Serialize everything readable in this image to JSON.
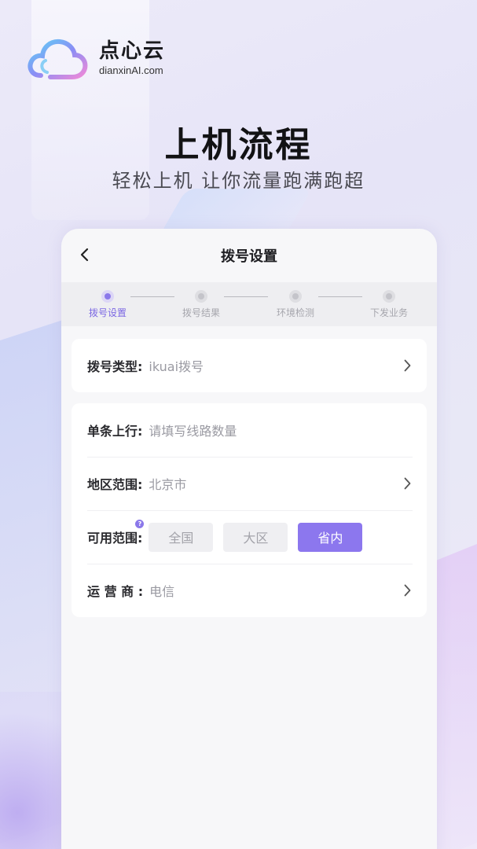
{
  "brand": {
    "name": "点心云",
    "domain": "dianxinAI.com"
  },
  "hero": {
    "title": "上机流程",
    "subtitle": "轻松上机 让你流量跑满跑超"
  },
  "card": {
    "title": "拨号设置",
    "steps": [
      {
        "label": "拨号设置",
        "active": true
      },
      {
        "label": "拨号结果",
        "active": false
      },
      {
        "label": "环境检测",
        "active": false
      },
      {
        "label": "下发业务",
        "active": false
      }
    ],
    "dial_type": {
      "label": "拨号类型:",
      "value": "ikuai拨号"
    },
    "uplink": {
      "label": "单条上行:",
      "placeholder": "请填写线路数量"
    },
    "region": {
      "label": "地区范围:",
      "value": "北京市"
    },
    "available_range": {
      "label": "可用范围:",
      "help": "?",
      "options": [
        "全国",
        "大区",
        "省内"
      ],
      "selected": "省内"
    },
    "operator": {
      "label": "运 营 商 :",
      "value": "电信"
    }
  },
  "colors": {
    "accent": "#8c77ee",
    "step_active": "#7b67e3"
  }
}
